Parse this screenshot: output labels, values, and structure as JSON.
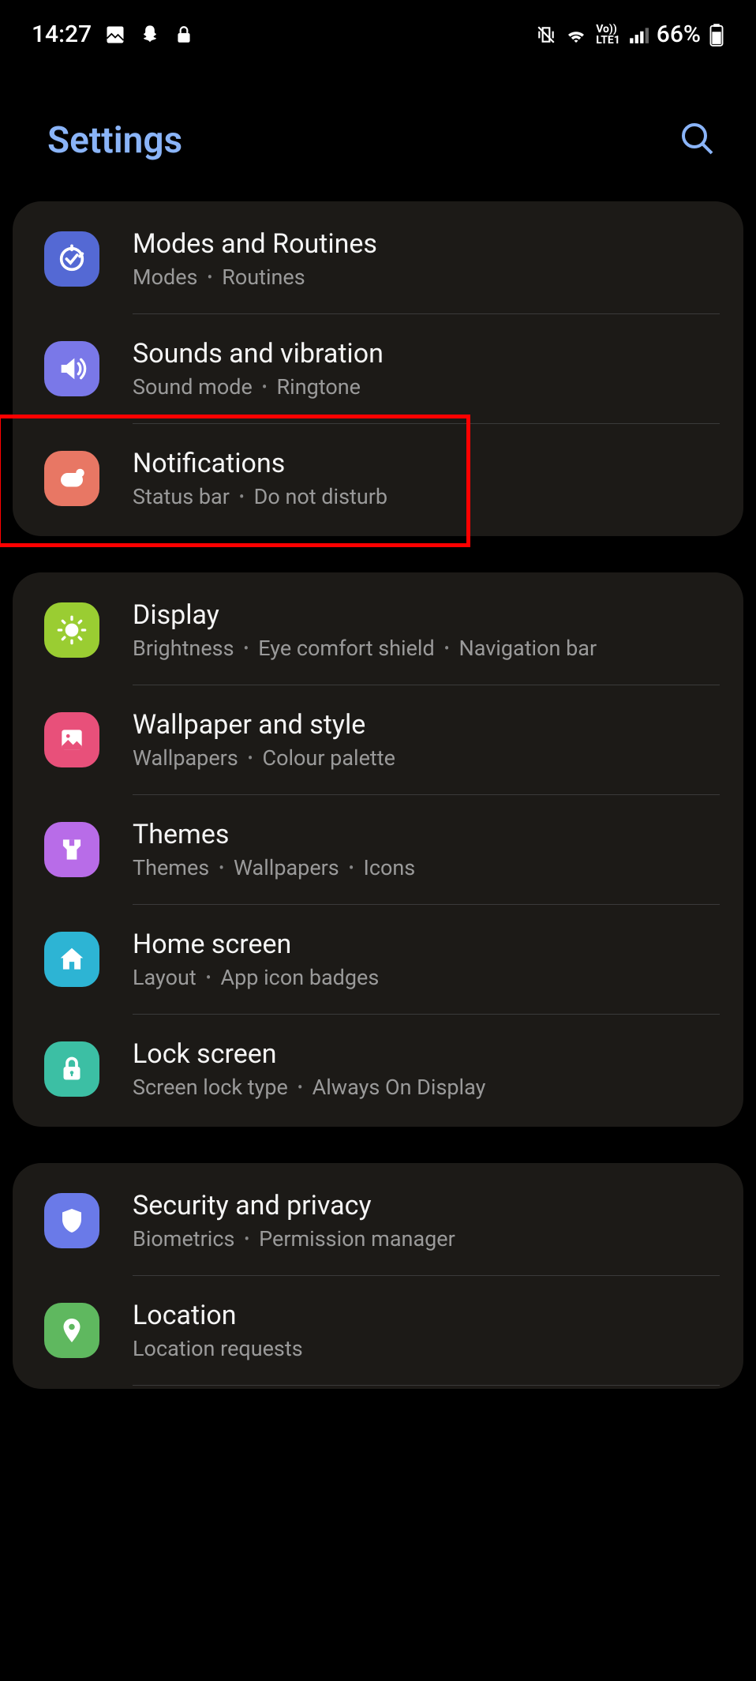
{
  "status": {
    "time": "14:27",
    "battery": "66%"
  },
  "header": {
    "title": "Settings"
  },
  "sections": [
    {
      "items": [
        {
          "id": "modes",
          "title": "Modes and Routines",
          "subtitle": [
            "Modes",
            "Routines"
          ]
        },
        {
          "id": "sounds",
          "title": "Sounds and vibration",
          "subtitle": [
            "Sound mode",
            "Ringtone"
          ]
        },
        {
          "id": "notifications",
          "title": "Notifications",
          "subtitle": [
            "Status bar",
            "Do not disturb"
          ],
          "highlighted": true
        }
      ]
    },
    {
      "items": [
        {
          "id": "display",
          "title": "Display",
          "subtitle": [
            "Brightness",
            "Eye comfort shield",
            "Navigation bar"
          ]
        },
        {
          "id": "wallpaper",
          "title": "Wallpaper and style",
          "subtitle": [
            "Wallpapers",
            "Colour palette"
          ]
        },
        {
          "id": "themes",
          "title": "Themes",
          "subtitle": [
            "Themes",
            "Wallpapers",
            "Icons"
          ]
        },
        {
          "id": "home",
          "title": "Home screen",
          "subtitle": [
            "Layout",
            "App icon badges"
          ]
        },
        {
          "id": "lock",
          "title": "Lock screen",
          "subtitle": [
            "Screen lock type",
            "Always On Display"
          ]
        }
      ]
    },
    {
      "items": [
        {
          "id": "security",
          "title": "Security and privacy",
          "subtitle": [
            "Biometrics",
            "Permission manager"
          ]
        },
        {
          "id": "location",
          "title": "Location",
          "subtitle": [
            "Location requests"
          ]
        }
      ]
    }
  ]
}
